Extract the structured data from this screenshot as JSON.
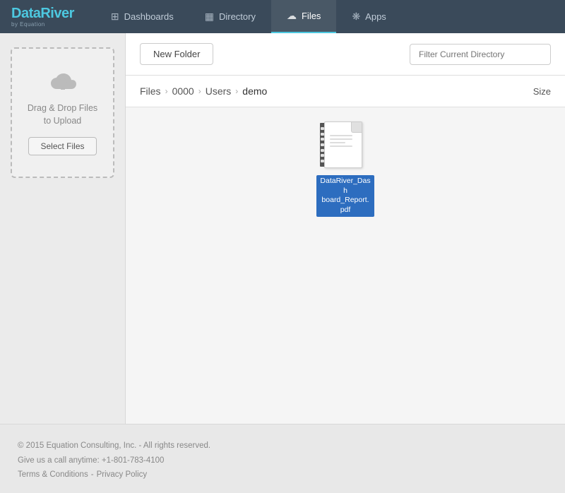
{
  "nav": {
    "logo": {
      "main": "DataRiver",
      "sub": "by Equation"
    },
    "items": [
      {
        "id": "dashboards",
        "label": "Dashboards",
        "icon": "⊞",
        "active": false
      },
      {
        "id": "directory",
        "label": "Directory",
        "icon": "▦",
        "active": false
      },
      {
        "id": "files",
        "label": "Files",
        "icon": "☁",
        "active": true
      },
      {
        "id": "apps",
        "label": "Apps",
        "icon": "❋",
        "active": false
      }
    ]
  },
  "sidebar": {
    "drop_text": "Drag & Drop Files to Upload",
    "select_files_label": "Select Files"
  },
  "toolbar": {
    "new_folder_label": "New Folder",
    "filter_placeholder": "Filter Current Directory"
  },
  "breadcrumb": {
    "items": [
      "Files",
      "0000",
      "Users",
      "demo"
    ],
    "size_label": "Size"
  },
  "files": [
    {
      "name": "DataRiver_Dashboard_Report.pdf",
      "display_name": "DataRiver_Dash\nboard_Report.pdf",
      "type": "pdf"
    }
  ],
  "footer": {
    "copyright": "© 2015 Equation Consulting, Inc. - All rights reserved.",
    "phone": "Give us a call anytime: +1-801-783-4100",
    "terms_label": "Terms & Conditions",
    "separator": " - ",
    "privacy_label": "Privacy Policy"
  }
}
